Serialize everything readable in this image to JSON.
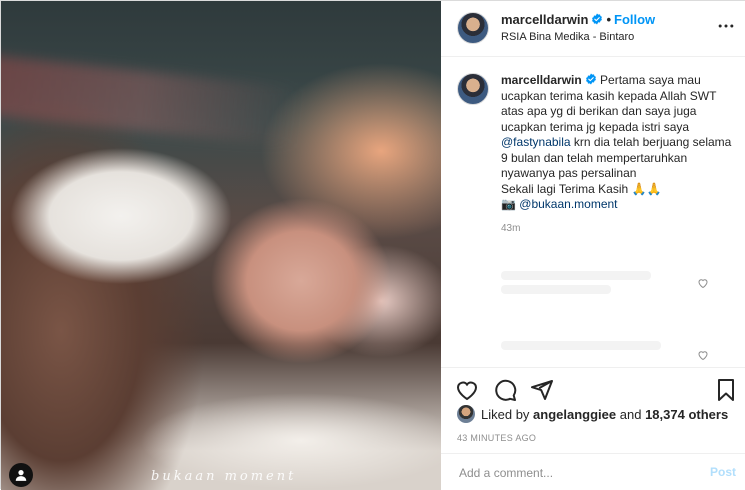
{
  "post": {
    "username": "marcelldarwin",
    "follow_label": "Follow",
    "dot": "•",
    "location": "RSIA Bina Medika - Bintaro",
    "media_watermark": "bukaan moment",
    "caption": {
      "text_1": "Pertama saya mau ucapkan terima kasih kepada Allah SWT atas apa yg di berikan dan saya juga ucapkan terima jg kepada istri saya ",
      "mention_1": "@fastynabila",
      "text_2": " krn dia telah berjuang selama 9 bulan dan telah mempertaruhkan nyawanya pas persalinan\nSekali lagi Terima Kasih 🙏🙏\n📷 ",
      "mention_2": "@bukaan.moment",
      "time": "43m"
    },
    "likes": {
      "prefix": "Liked by ",
      "user": "angelanggiee",
      "middle": " and ",
      "count": "18,374 others"
    },
    "posted_ago": "43 MINUTES AGO",
    "comment_placeholder": "Add a comment...",
    "post_label": "Post"
  },
  "colors": {
    "accent": "#0095f6",
    "mention": "#00376b",
    "muted": "#8e8e8e",
    "post_disabled": "#b2dffc"
  },
  "icons": [
    "verified-badge-icon",
    "more-options-icon",
    "heart-icon",
    "comment-icon",
    "share-icon",
    "bookmark-icon",
    "user-tag-icon"
  ]
}
